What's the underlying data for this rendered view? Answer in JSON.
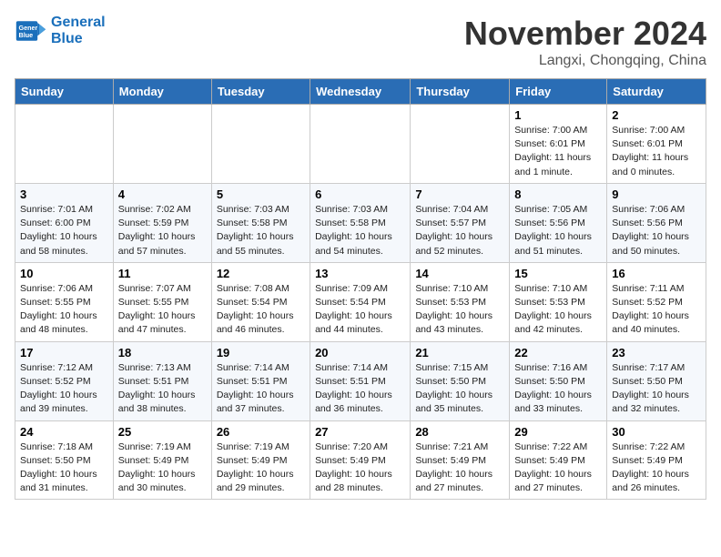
{
  "header": {
    "logo_line1": "General",
    "logo_line2": "Blue",
    "month_year": "November 2024",
    "location": "Langxi, Chongqing, China"
  },
  "weekdays": [
    "Sunday",
    "Monday",
    "Tuesday",
    "Wednesday",
    "Thursday",
    "Friday",
    "Saturday"
  ],
  "weeks": [
    [
      {
        "day": "",
        "info": ""
      },
      {
        "day": "",
        "info": ""
      },
      {
        "day": "",
        "info": ""
      },
      {
        "day": "",
        "info": ""
      },
      {
        "day": "",
        "info": ""
      },
      {
        "day": "1",
        "info": "Sunrise: 7:00 AM\nSunset: 6:01 PM\nDaylight: 11 hours and 1 minute."
      },
      {
        "day": "2",
        "info": "Sunrise: 7:00 AM\nSunset: 6:01 PM\nDaylight: 11 hours and 0 minutes."
      }
    ],
    [
      {
        "day": "3",
        "info": "Sunrise: 7:01 AM\nSunset: 6:00 PM\nDaylight: 10 hours and 58 minutes."
      },
      {
        "day": "4",
        "info": "Sunrise: 7:02 AM\nSunset: 5:59 PM\nDaylight: 10 hours and 57 minutes."
      },
      {
        "day": "5",
        "info": "Sunrise: 7:03 AM\nSunset: 5:58 PM\nDaylight: 10 hours and 55 minutes."
      },
      {
        "day": "6",
        "info": "Sunrise: 7:03 AM\nSunset: 5:58 PM\nDaylight: 10 hours and 54 minutes."
      },
      {
        "day": "7",
        "info": "Sunrise: 7:04 AM\nSunset: 5:57 PM\nDaylight: 10 hours and 52 minutes."
      },
      {
        "day": "8",
        "info": "Sunrise: 7:05 AM\nSunset: 5:56 PM\nDaylight: 10 hours and 51 minutes."
      },
      {
        "day": "9",
        "info": "Sunrise: 7:06 AM\nSunset: 5:56 PM\nDaylight: 10 hours and 50 minutes."
      }
    ],
    [
      {
        "day": "10",
        "info": "Sunrise: 7:06 AM\nSunset: 5:55 PM\nDaylight: 10 hours and 48 minutes."
      },
      {
        "day": "11",
        "info": "Sunrise: 7:07 AM\nSunset: 5:55 PM\nDaylight: 10 hours and 47 minutes."
      },
      {
        "day": "12",
        "info": "Sunrise: 7:08 AM\nSunset: 5:54 PM\nDaylight: 10 hours and 46 minutes."
      },
      {
        "day": "13",
        "info": "Sunrise: 7:09 AM\nSunset: 5:54 PM\nDaylight: 10 hours and 44 minutes."
      },
      {
        "day": "14",
        "info": "Sunrise: 7:10 AM\nSunset: 5:53 PM\nDaylight: 10 hours and 43 minutes."
      },
      {
        "day": "15",
        "info": "Sunrise: 7:10 AM\nSunset: 5:53 PM\nDaylight: 10 hours and 42 minutes."
      },
      {
        "day": "16",
        "info": "Sunrise: 7:11 AM\nSunset: 5:52 PM\nDaylight: 10 hours and 40 minutes."
      }
    ],
    [
      {
        "day": "17",
        "info": "Sunrise: 7:12 AM\nSunset: 5:52 PM\nDaylight: 10 hours and 39 minutes."
      },
      {
        "day": "18",
        "info": "Sunrise: 7:13 AM\nSunset: 5:51 PM\nDaylight: 10 hours and 38 minutes."
      },
      {
        "day": "19",
        "info": "Sunrise: 7:14 AM\nSunset: 5:51 PM\nDaylight: 10 hours and 37 minutes."
      },
      {
        "day": "20",
        "info": "Sunrise: 7:14 AM\nSunset: 5:51 PM\nDaylight: 10 hours and 36 minutes."
      },
      {
        "day": "21",
        "info": "Sunrise: 7:15 AM\nSunset: 5:50 PM\nDaylight: 10 hours and 35 minutes."
      },
      {
        "day": "22",
        "info": "Sunrise: 7:16 AM\nSunset: 5:50 PM\nDaylight: 10 hours and 33 minutes."
      },
      {
        "day": "23",
        "info": "Sunrise: 7:17 AM\nSunset: 5:50 PM\nDaylight: 10 hours and 32 minutes."
      }
    ],
    [
      {
        "day": "24",
        "info": "Sunrise: 7:18 AM\nSunset: 5:50 PM\nDaylight: 10 hours and 31 minutes."
      },
      {
        "day": "25",
        "info": "Sunrise: 7:19 AM\nSunset: 5:49 PM\nDaylight: 10 hours and 30 minutes."
      },
      {
        "day": "26",
        "info": "Sunrise: 7:19 AM\nSunset: 5:49 PM\nDaylight: 10 hours and 29 minutes."
      },
      {
        "day": "27",
        "info": "Sunrise: 7:20 AM\nSunset: 5:49 PM\nDaylight: 10 hours and 28 minutes."
      },
      {
        "day": "28",
        "info": "Sunrise: 7:21 AM\nSunset: 5:49 PM\nDaylight: 10 hours and 27 minutes."
      },
      {
        "day": "29",
        "info": "Sunrise: 7:22 AM\nSunset: 5:49 PM\nDaylight: 10 hours and 27 minutes."
      },
      {
        "day": "30",
        "info": "Sunrise: 7:22 AM\nSunset: 5:49 PM\nDaylight: 10 hours and 26 minutes."
      }
    ]
  ]
}
